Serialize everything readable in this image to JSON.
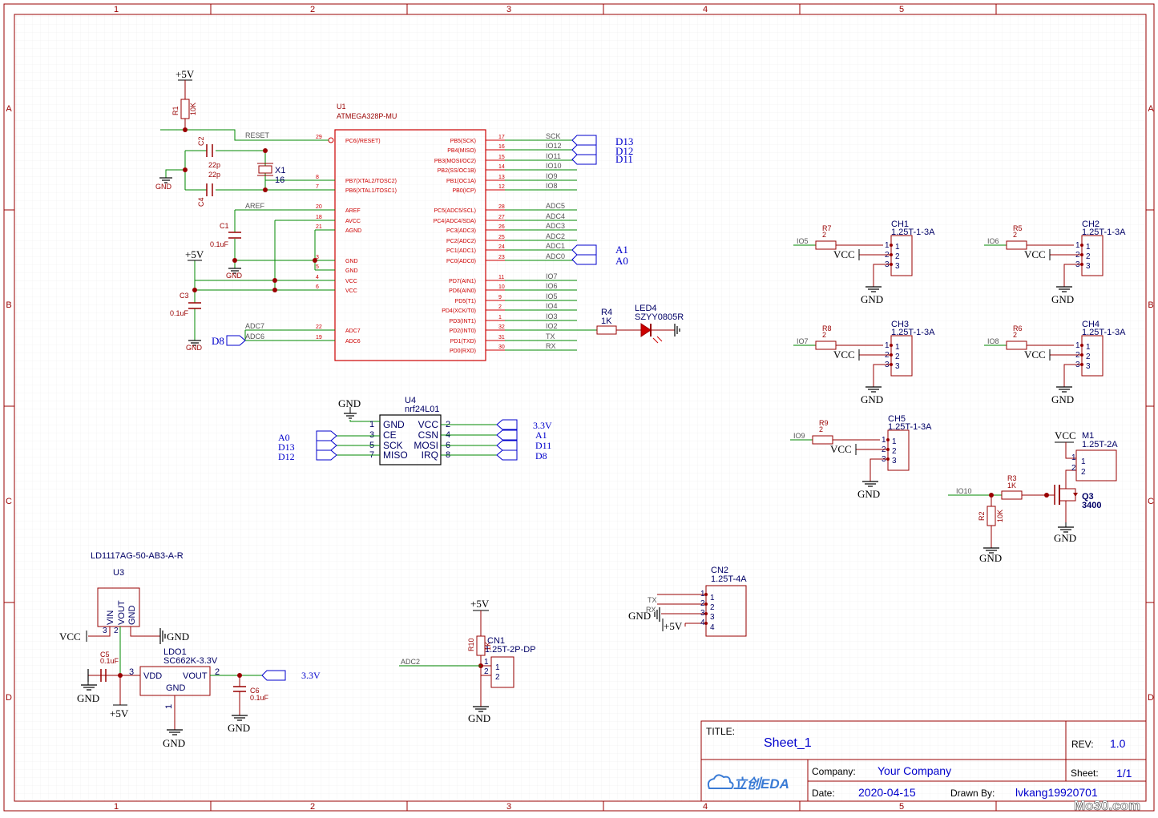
{
  "frame": {
    "col_labels": [
      "1",
      "2",
      "3",
      "4",
      "5"
    ],
    "row_labels": [
      "A",
      "B",
      "C",
      "D"
    ]
  },
  "colors": {
    "border": "#990000",
    "wire": "#008800",
    "part": "#990000",
    "text_blue": "#0000cc",
    "netport": "#0000cc",
    "grid": "#ececec"
  },
  "u1": {
    "ref": "U1",
    "part": "ATMEGA328P-MU",
    "left_pins": [
      {
        "num": "29",
        "name": "PC6(/RESET)"
      },
      {
        "num": "8",
        "name": "PB7(XTAL2/TOSC2)"
      },
      {
        "num": "7",
        "name": "PB6(XTAL1/TOSC1)"
      },
      {
        "num": "20",
        "name": "AREF"
      },
      {
        "num": "18",
        "name": "AVCC"
      },
      {
        "num": "21",
        "name": "AGND"
      },
      {
        "num": "3",
        "name": "GND"
      },
      {
        "num": "5",
        "name": "GND"
      },
      {
        "num": "4",
        "name": "VCC"
      },
      {
        "num": "6",
        "name": "VCC"
      },
      {
        "num": "22",
        "name": "ADC7"
      },
      {
        "num": "19",
        "name": "ADC6"
      }
    ],
    "right_pins": [
      {
        "num": "17",
        "name": "PB5(SCK)",
        "net": "SCK"
      },
      {
        "num": "16",
        "name": "PB4(MISO)",
        "net": "IO12"
      },
      {
        "num": "15",
        "name": "PB3(MOSI/OC2)",
        "net": "IO11"
      },
      {
        "num": "14",
        "name": "PB2(SS/OC1B)",
        "net": "IO10"
      },
      {
        "num": "13",
        "name": "PB1(OC1A)",
        "net": "IO9"
      },
      {
        "num": "12",
        "name": "PB0(ICP)",
        "net": "IO8"
      },
      {
        "num": "28",
        "name": "PC5(ADC5/SCL)",
        "net": "ADC5"
      },
      {
        "num": "27",
        "name": "PC4(ADC4/SDA)",
        "net": "ADC4"
      },
      {
        "num": "26",
        "name": "PC3(ADC3)",
        "net": "ADC3"
      },
      {
        "num": "25",
        "name": "PC2(ADC2)",
        "net": "ADC2"
      },
      {
        "num": "24",
        "name": "PC1(ADC1)",
        "net": "ADC1"
      },
      {
        "num": "23",
        "name": "PC0(ADC0)",
        "net": "ADC0"
      },
      {
        "num": "11",
        "name": "PD7(AIN1)",
        "net": "IO7"
      },
      {
        "num": "10",
        "name": "PD6(AIN0)",
        "net": "IO6"
      },
      {
        "num": "9",
        "name": "PD5(T1)",
        "net": "IO5"
      },
      {
        "num": "2",
        "name": "PD4(XCK/T0)",
        "net": "IO4"
      },
      {
        "num": "1",
        "name": "PD3(INT1)",
        "net": "IO3"
      },
      {
        "num": "32",
        "name": "PD2(INT0)",
        "net": "IO2"
      },
      {
        "num": "31",
        "name": "PD1(TXD)",
        "net": "TX"
      },
      {
        "num": "30",
        "name": "PD0(RXD)",
        "net": "RX"
      }
    ],
    "left_nets": {
      "reset": "RESET",
      "aref": "AREF",
      "adc7": "ADC7",
      "adc6": "ADC6"
    }
  },
  "reset_circuit": {
    "supply": "+5V",
    "r1_ref": "R1",
    "r1_val": "10K",
    "c2_ref": "C2",
    "c2_val": "22p",
    "c4_ref": "C4",
    "c4_val": "22p",
    "x1_ref": "X1",
    "x1_val": "16",
    "gnd": "GND",
    "c1_ref": "C1",
    "c1_val": "0.1uF",
    "gnd2": "GND",
    "supply2": "+5V",
    "c3_ref": "C3",
    "c3_val": "0.1uF",
    "gnd3": "GND",
    "d8_port": "D8"
  },
  "right_ports": {
    "d13": "D13",
    "d12": "D12",
    "d11": "D11",
    "a1": "A1",
    "a0": "A0"
  },
  "led": {
    "r4_ref": "R4",
    "r4_val": "1K",
    "led_ref": "LED4",
    "led_val": "SZYY0805R"
  },
  "u4": {
    "ref": "U4",
    "part": "nrf24L01",
    "gnd": "GND",
    "left_pins": [
      {
        "num": "1",
        "name": "GND"
      },
      {
        "num": "3",
        "name": "CE"
      },
      {
        "num": "5",
        "name": "SCK"
      },
      {
        "num": "7",
        "name": "MISO"
      }
    ],
    "right_pins": [
      {
        "num": "2",
        "name": "VCC"
      },
      {
        "num": "4",
        "name": "CSN"
      },
      {
        "num": "6",
        "name": "MOSI"
      },
      {
        "num": "8",
        "name": "IRQ"
      }
    ],
    "left_ports": [
      "A0",
      "D13",
      "D12"
    ],
    "right_ports": [
      "3.3V",
      "A1",
      "D11",
      "D8"
    ]
  },
  "channels": [
    {
      "ref": "CH1",
      "part": "1.25T-1-3A",
      "net": "IO5",
      "r_ref": "R7",
      "r_val": "2",
      "vcc": "VCC",
      "gnd": "GND"
    },
    {
      "ref": "CH2",
      "part": "1.25T-1-3A",
      "net": "IO6",
      "r_ref": "R5",
      "r_val": "2",
      "vcc": "VCC",
      "gnd": "GND"
    },
    {
      "ref": "CH3",
      "part": "1.25T-1-3A",
      "net": "IO7",
      "r_ref": "R8",
      "r_val": "2",
      "vcc": "VCC",
      "gnd": "GND"
    },
    {
      "ref": "CH4",
      "part": "1.25T-1-3A",
      "net": "IO8",
      "r_ref": "R6",
      "r_val": "2",
      "vcc": "VCC",
      "gnd": "GND"
    },
    {
      "ref": "CH5",
      "part": "1.25T-1-3A",
      "net": "IO9",
      "r_ref": "R9",
      "r_val": "2",
      "vcc": "VCC",
      "gnd": "GND"
    }
  ],
  "motor": {
    "vcc": "VCC",
    "m_ref": "M1",
    "m_part": "1.25T-2A",
    "net": "IO10",
    "r3_ref": "R3",
    "r3_val": "1K",
    "q_ref": "Q3",
    "q_val": "3400",
    "r2_ref": "R2",
    "r2_val": "10K",
    "gnd": "GND",
    "gnd2": "GND"
  },
  "u3": {
    "title": "LD1117AG-50-AB3-A-R",
    "ref": "U3",
    "pins": [
      "VIN",
      "VOUT",
      "GND"
    ],
    "vcc": "VCC",
    "gnd": "GND",
    "ldo_ref": "LDO1",
    "ldo_part": "SC662K-3.3V",
    "ldo_vdd": "VDD",
    "ldo_vout": "VOUT",
    "ldo_gnd": "GND",
    "c5_ref": "C5",
    "c5_val": "0.1uF",
    "c6_ref": "C6",
    "c6_val": "0.1uF",
    "gnd_c5": "GND",
    "plus5": "+5V",
    "gnd_ldo": "GND",
    "gnd_c6": "GND",
    "port_33": "3.3V"
  },
  "cn1": {
    "supply": "+5V",
    "r10_ref": "R10",
    "r10_val": "1K",
    "ref": "CN1",
    "part": "1.25T-2P-DP",
    "net": "ADC2",
    "gnd": "GND"
  },
  "cn2": {
    "ref": "CN2",
    "part": "1.25T-4A",
    "nets": [
      "TX",
      "RX"
    ],
    "gnd": "GND",
    "plus5": "+5V"
  },
  "title_block": {
    "title_label": "TITLE:",
    "title": "Sheet_1",
    "rev_label": "REV:",
    "rev": "1.0",
    "company_label": "Company:",
    "company": "Your Company",
    "sheet_label": "Sheet:",
    "sheet": "1/1",
    "date_label": "Date:",
    "date": "2020-04-15",
    "drawn_label": "Drawn By:",
    "drawn": "lvkang19920701",
    "logo_text": "立创EDA",
    "watermark": "Mo30.com"
  }
}
